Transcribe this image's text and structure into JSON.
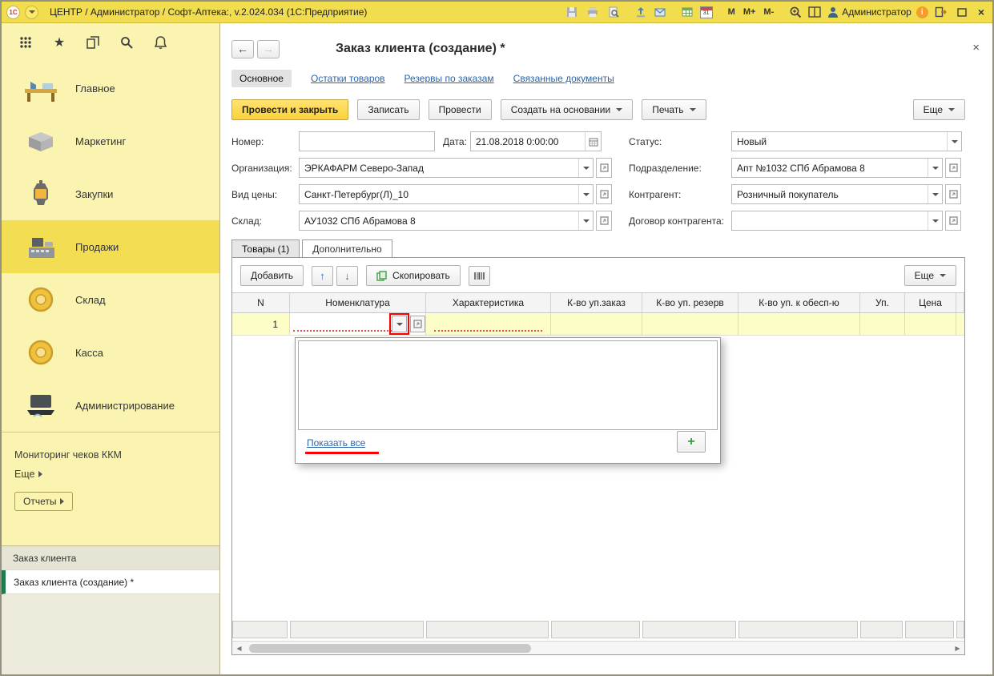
{
  "titlebar": {
    "title": "ЦЕНТР / Администратор / Софт-Аптека:, v.2.024.034 (1С:Предприятие)",
    "logo": "1С",
    "m": "M",
    "m_plus": "M+",
    "m_minus": "M-",
    "user": "Администратор",
    "calendar_day": "31",
    "info": "i"
  },
  "icons": {
    "back": "←",
    "forward": "→",
    "star": "★",
    "close": "×",
    "plus": "+",
    "scroll_left": "◀",
    "scroll_right": "▶",
    "row_up": "↑",
    "row_down": "↓"
  },
  "sidebar": {
    "sections": [
      {
        "label": "Главное"
      },
      {
        "label": "Маркетинг"
      },
      {
        "label": "Закупки"
      },
      {
        "label": "Продажи"
      },
      {
        "label": "Склад"
      },
      {
        "label": "Касса"
      },
      {
        "label": "Администрирование"
      }
    ],
    "monitoring": "Мониторинг чеков ККМ",
    "more": "Еще",
    "reports": "Отчеты",
    "windows": [
      {
        "label": "Заказ клиента"
      },
      {
        "label": "Заказ клиента (создание) *"
      }
    ]
  },
  "doc": {
    "title": "Заказ клиента (создание) *",
    "tabs": {
      "main": "Основное",
      "links": [
        "Остатки товаров",
        "Резервы по заказам",
        "Связанные документы"
      ]
    },
    "commands": {
      "post_close": "Провести и закрыть",
      "save": "Записать",
      "post": "Провести",
      "create_from": "Создать на основании",
      "print": "Печать",
      "more": "Еще"
    },
    "form": {
      "number_label": "Номер:",
      "date_label": "Дата:",
      "date_value": "21.08.2018 0:00:00",
      "status_label": "Статус:",
      "status_value": "Новый",
      "org_label": "Организация:",
      "org_value": "ЭРКАФАРМ Северо-Запад",
      "dept_label": "Подразделение:",
      "dept_value": "Апт №1032 СПб Абрамова 8",
      "price_label": "Вид цены:",
      "price_value": "Санкт-Петербург(Л)_10",
      "partner_label": "Контрагент:",
      "partner_value": "Розничный покупатель",
      "wh_label": "Склад:",
      "wh_value": "АУ1032 СПб Абрамова 8",
      "contract_label": "Договор контрагента:"
    },
    "grid_tabs": {
      "goods": "Товары (1)",
      "extra": "Дополнительно"
    },
    "grid_toolbar": {
      "add": "Добавить",
      "copy": "Скопировать",
      "more": "Еще"
    },
    "grid": {
      "columns": [
        "N",
        "Номенклатура",
        "Характеристика",
        "К-во уп.заказ",
        "К-во уп. резерв",
        "К-во уп. к обесп-ю",
        "Уп.",
        "Цена"
      ],
      "row_number": "1"
    },
    "dropdown": {
      "show_all": "Показать все"
    }
  }
}
